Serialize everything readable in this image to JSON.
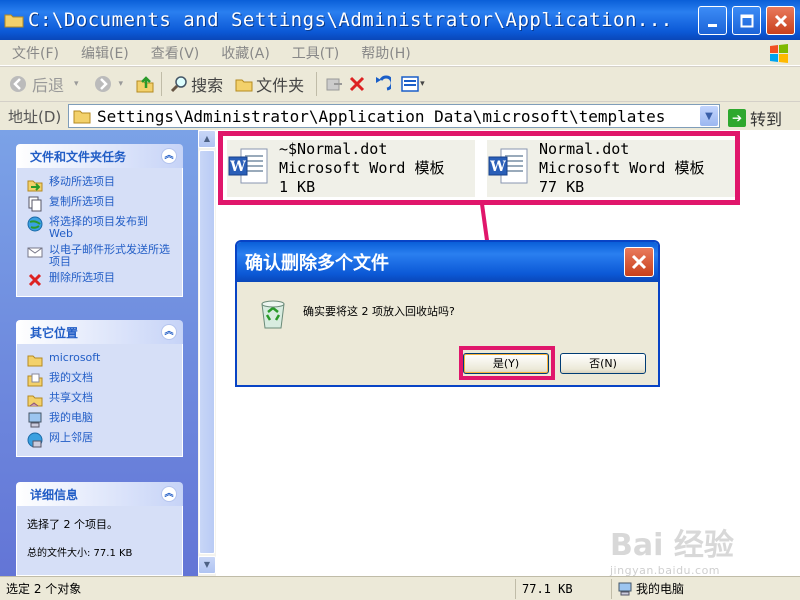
{
  "window": {
    "title": "C:\\Documents and Settings\\Administrator\\Application..."
  },
  "menu": [
    "文件(F)",
    "编辑(E)",
    "查看(V)",
    "收藏(A)",
    "工具(T)",
    "帮助(H)"
  ],
  "toolbar": {
    "back_label": "后退",
    "search_label": "搜索",
    "folders_label": "文件夹"
  },
  "address": {
    "label": "地址(D)",
    "value": "Settings\\Administrator\\Application Data\\microsoft\\templates",
    "go_label": "转到"
  },
  "tasks": {
    "file_tasks": {
      "title": "文件和文件夹任务",
      "items": [
        "移动所选项目",
        "复制所选项目",
        "将选择的项目发布到 Web",
        "以电子邮件形式发送所选项目",
        "删除所选项目"
      ]
    },
    "other_places": {
      "title": "其它位置",
      "items": [
        "microsoft",
        "我的文档",
        "共享文档",
        "我的电脑",
        "网上邻居"
      ]
    },
    "details": {
      "title": "详细信息",
      "selected_text": "选择了 2 个项目。",
      "total_size": "总的文件大小: 77.1 KB"
    }
  },
  "files": [
    {
      "name": "~$Normal.dot",
      "type": "Microsoft Word 模板",
      "size": "1 KB"
    },
    {
      "name": "Normal.dot",
      "type": "Microsoft Word 模板",
      "size": "77 KB"
    }
  ],
  "dialog": {
    "title": "确认删除多个文件",
    "message": "确实要将这 2 项放入回收站吗?",
    "yes_label": "是(Y)",
    "no_label": "否(N)"
  },
  "status": {
    "selection": "选定 2 个对象",
    "size": "77.1 KB",
    "location": "我的电脑"
  },
  "watermark": {
    "brand": "Bai 经验",
    "url": "jingyan.baidu.com"
  },
  "colors": {
    "highlight": "#e0166b",
    "xp_blue": "#0a5fd8",
    "taskpane_link": "#215dc6"
  }
}
